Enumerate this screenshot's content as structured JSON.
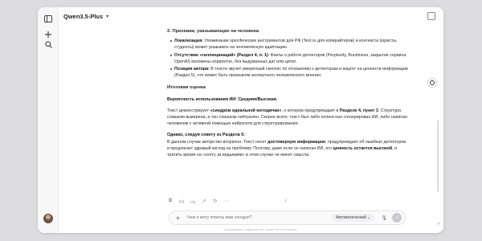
{
  "app": {
    "model_name": "Qwen3.5-Plus",
    "accent": "#1f1f23",
    "background": "#dcdcdf"
  },
  "rail": {
    "icons": [
      "sidebar-toggle-icon",
      "new-chat-icon",
      "search-icon"
    ]
  },
  "content": {
    "heading": "2. Признаки, указывающие на человека",
    "bullets": [
      {
        "bold": "Локализация:",
        "text": " Упоминание specifических инструментов для РФ (Text.ru для копирайтеров) и контекста (юристы, студенты) может указывать на человеческую адаптацию."
      },
      {
        "bold": "Отсутствие «галлюцинаций» (Раздел 4, п. 1):",
        "text": " Факты о работе детекторов (Perplexity, Burstiness, закрытие сервиса OpenAI) изложены корректно, без выдуманных дат или цитат."
      },
      {
        "bold": "Позиция автора:",
        "text": " В тексте звучит умеренный скепсис по отношению к детекторам и акцент на ценности информации (Раздел 5), что может быть признаком экспертного человеческого мнения."
      }
    ],
    "summary_title": "Итоговая оценка",
    "probability": "Вероятность использования ИИ: Средняя/Высокая.",
    "para1_a": "Текст демонстрирует ",
    "para1_b": "«синдром идеальной методички»",
    "para1_c": ", о котором предупреждает в ",
    "para1_d": "Разделе 4, пункт 3",
    "para1_e": ". Структура слишком выверена, а тон слишком нейтрален. Скорее всего, текст был либо полностью сгенерирован ИИ, либо написан человеком с активной помощью нейросети для структурирования.",
    "advice_title": "Однако, следуя совету из Раздела 5:",
    "para2_a": "В данном случае авторство вторично. Текст несет ",
    "para2_b": "достоверную информацию",
    "para2_c": ", предупреждает об ошибках детекторов и предлагает здравый взгляд на проблему. Поэтому, даже если он написан ИИ, его ",
    "para2_d": "ценность остается высокой",
    "para2_e": ", и тратить время на «охоту за ведьмами» в этом случае не имеет смысла."
  },
  "actions": [
    "copy-icon",
    "like-icon",
    "dislike-icon",
    "share-icon",
    "regenerate-icon",
    "more-icon"
  ],
  "composer": {
    "placeholder": "Чем я могу помочь вам сегодня?",
    "mode": "Автоматический",
    "mode_chevron": "⌄"
  },
  "disclaimer": "Содержимое, созданное ИИ, может быть неточным."
}
